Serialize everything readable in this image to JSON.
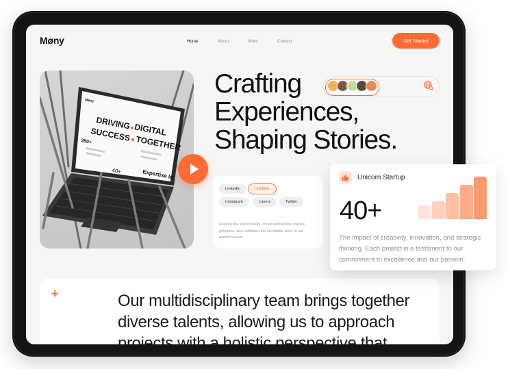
{
  "brand": {
    "logo": "Møny",
    "accent": "#ff6b35"
  },
  "nav": {
    "items": [
      "Home",
      "About",
      "Work",
      "Contact"
    ],
    "active": "Home",
    "cta_label": "Get Started"
  },
  "hero": {
    "headline": [
      "Crafting",
      "Experiences,",
      "Shaping Stories."
    ],
    "avatar_colors": [
      "#f0b35a",
      "#7a5548",
      "#c9d8a4",
      "#5c4a42",
      "#e58a5c"
    ],
    "image_icon": "laptop-image",
    "play_icon": "play-icon"
  },
  "social": {
    "chips": [
      "LinkedIn",
      "Dribbble",
      "Instagram",
      "Layers",
      "Twitter"
    ],
    "active_chip": "Dribbble",
    "text": "Explore the latest trends, share behind-the-scenes glimpses, and celebrate the incredible work of our talented team."
  },
  "stats": {
    "title": "Unicorn Startup",
    "number": "40+",
    "text": "The impact of creativity, innovation, and strategic thinking. Each project is a testament to our commitment to excellence and our passion.",
    "bars": [
      0.32,
      0.42,
      0.62,
      0.8,
      1.0
    ],
    "bar_colors": [
      "#ffe3d6",
      "#ffd1bc",
      "#ffbfa1",
      "#ffac86",
      "#ff9a6c"
    ]
  },
  "about": {
    "text": "Our multidisciplinary team brings together diverse talents, allowing us to approach projects with a holistic perspective that"
  },
  "laptop_screen": {
    "brand": "Møny",
    "headline_1": "DRIVING",
    "headline_1b": "DIGITAL",
    "headline_2": "SUCCESS",
    "headline_2b": "TOGETHER",
    "stat_1": "350+",
    "stat_2": "40+",
    "label": "Expertise In"
  }
}
